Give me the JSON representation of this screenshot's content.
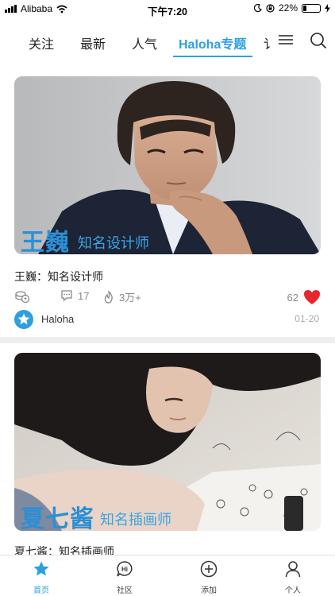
{
  "status_bar": {
    "carrier": "Alibaba",
    "time": "下午7:20",
    "battery": "22%",
    "battery_level": 0.22
  },
  "nav": {
    "tabs": [
      {
        "label": "关注"
      },
      {
        "label": "最新"
      },
      {
        "label": "人气"
      },
      {
        "label": "Haloha专题"
      },
      {
        "label": "讠"
      }
    ],
    "active_index": 3
  },
  "feed": [
    {
      "overlay_name": "王巍",
      "overlay_role": "知名设计师",
      "title": "王巍：知名设计师",
      "comments": "17",
      "heat": "3万+",
      "likes": "62",
      "author": "Haloha",
      "date": "01-20"
    },
    {
      "overlay_name": "夏七酱",
      "overlay_role": "知名插画师",
      "title": "夏七酱：知名插画师"
    }
  ],
  "tabbar": {
    "items": [
      {
        "label": "首页",
        "icon": "star-icon"
      },
      {
        "label": "社区",
        "icon": "hi-chat-icon"
      },
      {
        "label": "添加",
        "icon": "plus-circle-icon"
      },
      {
        "label": "个人",
        "icon": "person-icon"
      }
    ]
  },
  "colors": {
    "accent": "#2da0e0",
    "heart": "#e8262e",
    "divider": "#eeeeee"
  }
}
